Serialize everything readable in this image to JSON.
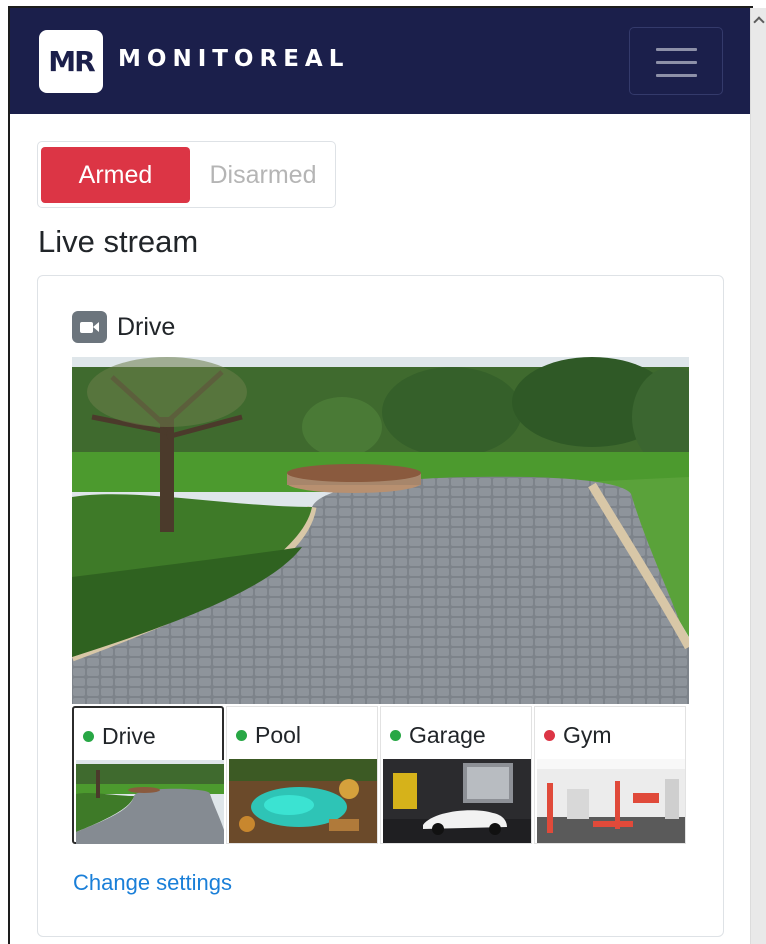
{
  "navbar": {
    "logo_text": "MR",
    "brand": "MONITOREAL",
    "menu_icon": "hamburger-icon",
    "background": "#1b1f4b"
  },
  "arm_toggle": {
    "armed_label": "Armed",
    "disarmed_label": "Disarmed",
    "selected": "Armed",
    "armed_color": "#dc3545"
  },
  "section": {
    "title": "Live stream"
  },
  "camera": {
    "icon": "video-camera-icon",
    "title": "Drive"
  },
  "thumbnails": [
    {
      "label": "Drive",
      "status": "online",
      "status_color": "#28a745",
      "active": true
    },
    {
      "label": "Pool",
      "status": "online",
      "status_color": "#28a745",
      "active": false
    },
    {
      "label": "Garage",
      "status": "online",
      "status_color": "#28a745",
      "active": false
    },
    {
      "label": "Gym",
      "status": "offline",
      "status_color": "#dc3545",
      "active": false
    }
  ],
  "footer": {
    "settings_link": "Change settings",
    "link_color": "#1a7fd8"
  }
}
